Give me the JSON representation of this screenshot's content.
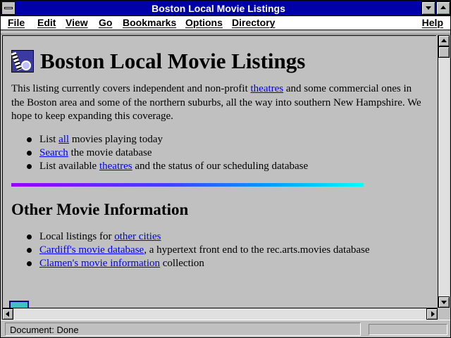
{
  "window": {
    "title": "Boston Local Movie Listings"
  },
  "menu": {
    "file": "File",
    "edit": "Edit",
    "view": "View",
    "go": "Go",
    "bookmarks": "Bookmarks",
    "options": "Options",
    "directory": "Directory",
    "help": "Help"
  },
  "page": {
    "heading": "Boston Local Movie Listings",
    "intro": {
      "before_link": "This listing currently covers independent and non-profit ",
      "link": "theatres",
      "after_link": " and some commercial ones in the Boston area and some of the northern suburbs, all the way into southern New Hampshire. We hope to keep expanding this coverage."
    },
    "list1": [
      {
        "before": "List ",
        "link": "all",
        "after": " movies playing today"
      },
      {
        "before": "",
        "link": "Search",
        "after": " the movie database"
      },
      {
        "before": "List available ",
        "link": "theatres",
        "after": " and the status of our scheduling database"
      }
    ],
    "subheading": "Other Movie Information",
    "list2": [
      {
        "before": "Local listings for ",
        "link": "other cities",
        "after": ""
      },
      {
        "before": "",
        "link": "Cardiff's movie database",
        "after": ", a hypertext front end to the rec.arts.movies database"
      },
      {
        "before": "",
        "link": "Clamen's movie information",
        "after": " collection"
      }
    ]
  },
  "status": {
    "text": "Document: Done"
  },
  "colors": {
    "title_bar": "#0000a8",
    "link": "#0000ee",
    "background": "#c0c0c0"
  }
}
